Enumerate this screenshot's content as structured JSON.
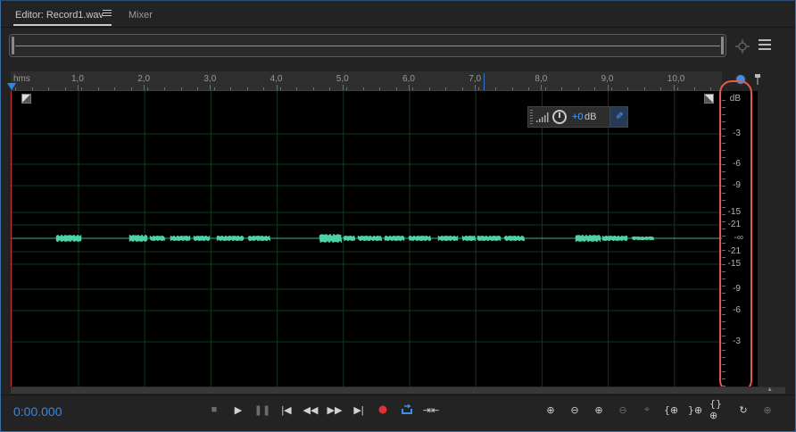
{
  "tabs": {
    "editor_label": "Editor: Record1.wav",
    "mixer_label": "Mixer"
  },
  "ruler": {
    "unit_label": "hms",
    "ticks": [
      "1,0",
      "2,0",
      "3,0",
      "4,0",
      "5,0",
      "6,0",
      "7,0",
      "8,0",
      "9,0",
      "10,0"
    ]
  },
  "hud": {
    "value": "+0",
    "unit": "dB"
  },
  "db_scale": {
    "header": "dB",
    "labels": [
      "-3",
      "-6",
      "-9",
      "-15",
      "-21",
      "-∞",
      "-21",
      "-15",
      "-9",
      "-6",
      "-3"
    ]
  },
  "transport": {
    "time": "0:00.000"
  },
  "colors": {
    "waveform": "#4fd1a8",
    "accent": "#2f82e6",
    "highlight": "#e25b4e",
    "record": "#e03030"
  },
  "icons": {
    "transport": [
      "stop-icon",
      "play-icon",
      "pause-icon",
      "go-to-start-icon",
      "rewind-icon",
      "fast-forward-icon",
      "go-to-end-icon",
      "record-icon",
      "loop-icon",
      "skip-selection-icon"
    ],
    "zoom": [
      "zoom-in-amplitude-icon",
      "zoom-out-amplitude-icon",
      "zoom-in-time-icon",
      "zoom-out-time-icon",
      "zoom-out-full-icon",
      "zoom-in-at-start-icon",
      "zoom-in-at-end-icon",
      "zoom-to-selection-icon",
      "zoom-reset-icon",
      "zoom-selected-tracks-icon"
    ]
  }
}
